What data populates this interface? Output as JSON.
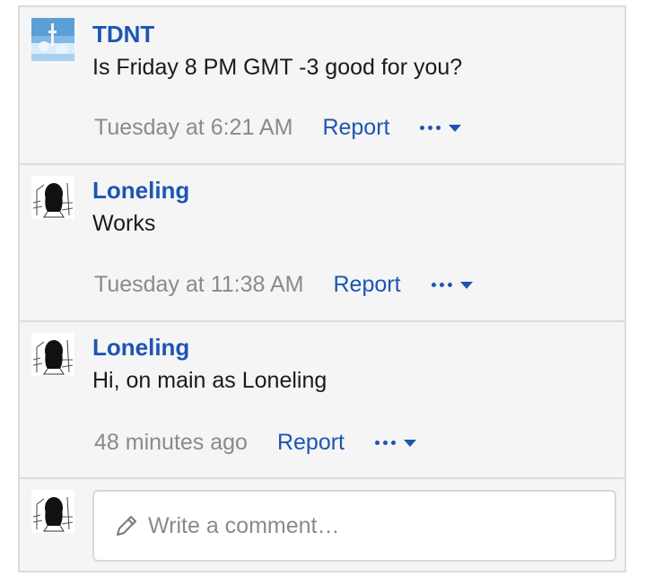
{
  "comments": [
    {
      "author": "TDNT",
      "text": "Is Friday 8 PM GMT -3 good for you?",
      "timestamp": "Tuesday at 6:21 AM",
      "report_label": "Report",
      "avatar": "landscape-avatar"
    },
    {
      "author": "Loneling",
      "text": "Works",
      "timestamp": "Tuesday at 11:38 AM",
      "report_label": "Report",
      "avatar": "sketch-avatar"
    },
    {
      "author": "Loneling",
      "text": "Hi, on main as Loneling",
      "timestamp": "48 minutes ago",
      "report_label": "Report",
      "avatar": "sketch-avatar"
    }
  ],
  "reply": {
    "placeholder": "Write a comment…"
  },
  "colors": {
    "link": "#1d55b4",
    "muted": "#8a8a8a",
    "background": "#f5f5f5",
    "border": "#dcdcdc"
  }
}
